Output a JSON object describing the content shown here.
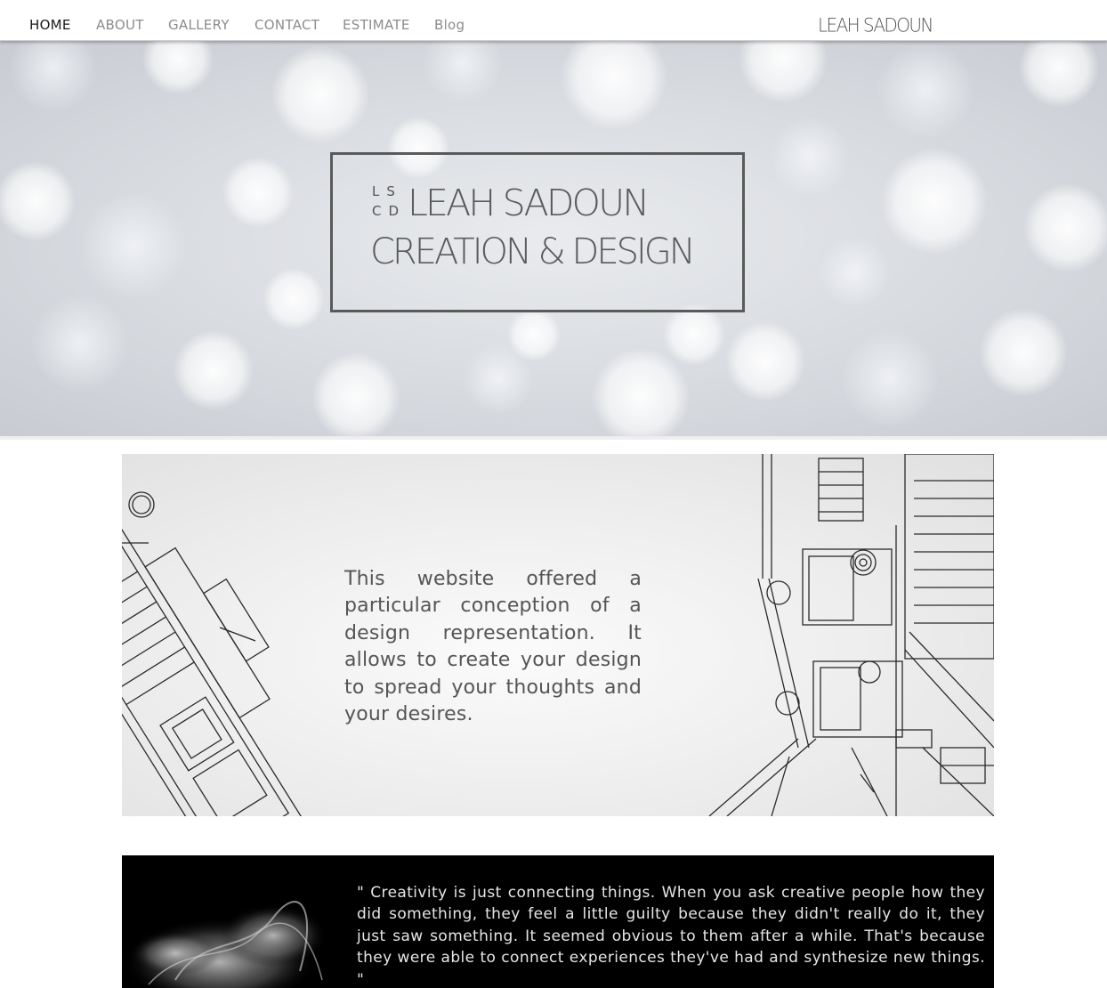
{
  "nav": {
    "items": [
      {
        "label": "HOME",
        "active": true
      },
      {
        "label": "ABOUT",
        "active": false
      },
      {
        "label": "GALLERY",
        "active": false
      },
      {
        "label": "CONTACT",
        "active": false
      },
      {
        "label": "ESTIMATE",
        "active": false
      },
      {
        "label": "Blog",
        "active": false
      }
    ],
    "brand": "LEAH SADOUN"
  },
  "hero": {
    "monogram_top": "LS",
    "monogram_bottom": "CD",
    "title_line1": "LEAH SADOUN",
    "title_line2": "CREATION & DESIGN"
  },
  "about": {
    "text": "This website offered a particular conception of a design representation. It allows to create your design to spread your thoughts and your desires."
  },
  "quote": {
    "text": "\" Creativity is just connecting things. When you ask creative people how they did something, they feel a little guilty because they didn't really do it, they just saw something. It seemed obvious to them after a while. That's because they were able to connect experiences they've had and synthesize new things. \""
  },
  "colors": {
    "nav_active": "#1a1a1a",
    "nav_inactive": "#8c8c8c",
    "hero_text": "#5a5a5a",
    "quote_bg": "#000000"
  }
}
